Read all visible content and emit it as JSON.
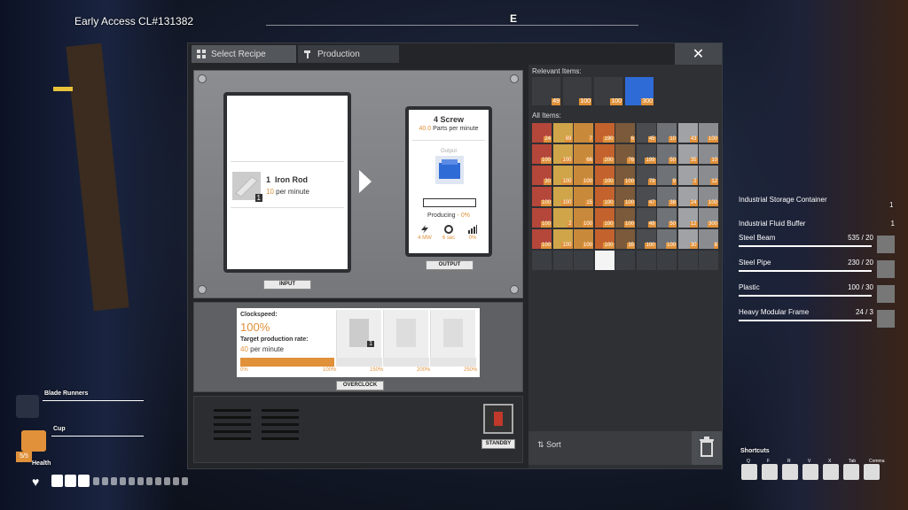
{
  "hud": {
    "build": "Early Access CL#131382",
    "compass": "E",
    "equip1": "Blade Runners",
    "equip2": "Cup",
    "cup_count": "5/5",
    "health": "Health"
  },
  "window": {
    "tabs": [
      {
        "label": "Select Recipe",
        "icon": "grid-icon"
      },
      {
        "label": "Production",
        "icon": "hammer-icon"
      }
    ],
    "close": "✕"
  },
  "machine": {
    "input": {
      "qty": "1",
      "name": "Iron Rod",
      "rate": "10",
      "unit": "per minute",
      "label": "INPUT"
    },
    "output": {
      "qty": "4",
      "name": "Screw",
      "rate": "40.0",
      "unit": "Parts per minute",
      "slot_label": "Output",
      "status": "Producing",
      "status_sep": " - ",
      "status_pct": "0%",
      "label": "OUTPUT",
      "stats": [
        {
          "icon": "power-icon",
          "value": "4 MW"
        },
        {
          "icon": "timer-icon",
          "value": "6 sec"
        },
        {
          "icon": "chart-icon",
          "value": "0%"
        }
      ]
    }
  },
  "overclock": {
    "clock_label": "Clockspeed:",
    "clock_value": "100%",
    "target_label": "Target production rate:",
    "target_value": "40",
    "target_unit": "per minute",
    "ticks": [
      "0%",
      "100%",
      "150%",
      "200%",
      "250%"
    ],
    "slot_qty": "1",
    "label": "OVERCLOCK"
  },
  "standby": {
    "label": "STANDBY"
  },
  "inventory": {
    "relevant_title": "Relevant Items:",
    "relevant": [
      "49",
      "100",
      "100",
      "300"
    ],
    "all_title": "All Items:",
    "items": [
      "24",
      "69",
      "7",
      "190",
      "6",
      "45",
      "10",
      "43",
      "100",
      "100",
      "100",
      "66",
      "200",
      "76",
      "199",
      "50",
      "35",
      "10",
      "30",
      "100",
      "100",
      "100",
      "100",
      "79",
      "9",
      "2",
      "12",
      "100",
      "100",
      "15",
      "100",
      "100",
      "47",
      "38",
      "24",
      "100",
      "100",
      "2",
      "100",
      "100",
      "100",
      "49",
      "50",
      "12",
      "300",
      "100",
      "100",
      "100",
      "100",
      "35",
      "100",
      "100",
      "30",
      "8"
    ],
    "sort": "Sort"
  },
  "storage": {
    "title": "Industrial Storage Container",
    "title_qty": "1",
    "buffer": "Industrial Fluid Buffer",
    "buffer_qty": "1",
    "rows": [
      {
        "name": "Steel Beam",
        "value": "535 / 20"
      },
      {
        "name": "Steel Pipe",
        "value": "230 / 20"
      },
      {
        "name": "Plastic",
        "value": "100 / 30"
      },
      {
        "name": "Heavy Modular Frame",
        "value": "24 / 3"
      }
    ]
  },
  "shortcuts": {
    "title": "Shortcuts",
    "keys": [
      "Q",
      "F",
      "R",
      "V",
      "X",
      "Tab",
      "Comma"
    ]
  },
  "colors": {
    "accent": "#e0913a",
    "window_bg": "#232528",
    "panel_gray": "#7e8083"
  }
}
